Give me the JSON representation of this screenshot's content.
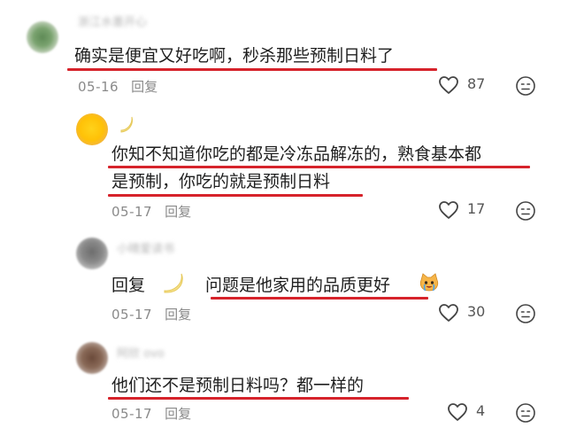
{
  "comments": [
    {
      "username": "浙江水墨开心",
      "text": "确实是便宜又好吃啊，秒杀那些预制日料了",
      "date": "05-16",
      "reply_label": "回复",
      "likes": "87"
    },
    {
      "username": "",
      "text_line1": "你知不知道你吃的都是冷冻品解冻的，熟食基本都",
      "text_line2": "是预制，你吃的就是预制日料",
      "date": "05-17",
      "reply_label": "回复",
      "likes": "17"
    },
    {
      "username": "小晴爱读书",
      "reply_prefix": "回复",
      "text": "问题是他家用的品质更好",
      "date": "05-17",
      "reply_label": "回复",
      "likes": "30"
    },
    {
      "username": "阿欣 ovo",
      "text": "他们还不是预制日料吗？都一样的",
      "date": "05-17",
      "reply_label": "回复",
      "likes": "4"
    }
  ],
  "icons": {
    "like": "heart-outline-icon",
    "dislike": "sad-face-icon",
    "emoji": "crying-cat-emoji",
    "badge": "banana-sticker-icon"
  },
  "colors": {
    "highlight_underline": "#d6232b",
    "meta_text": "#8a8a8a",
    "body_text": "#1f1f1f"
  }
}
